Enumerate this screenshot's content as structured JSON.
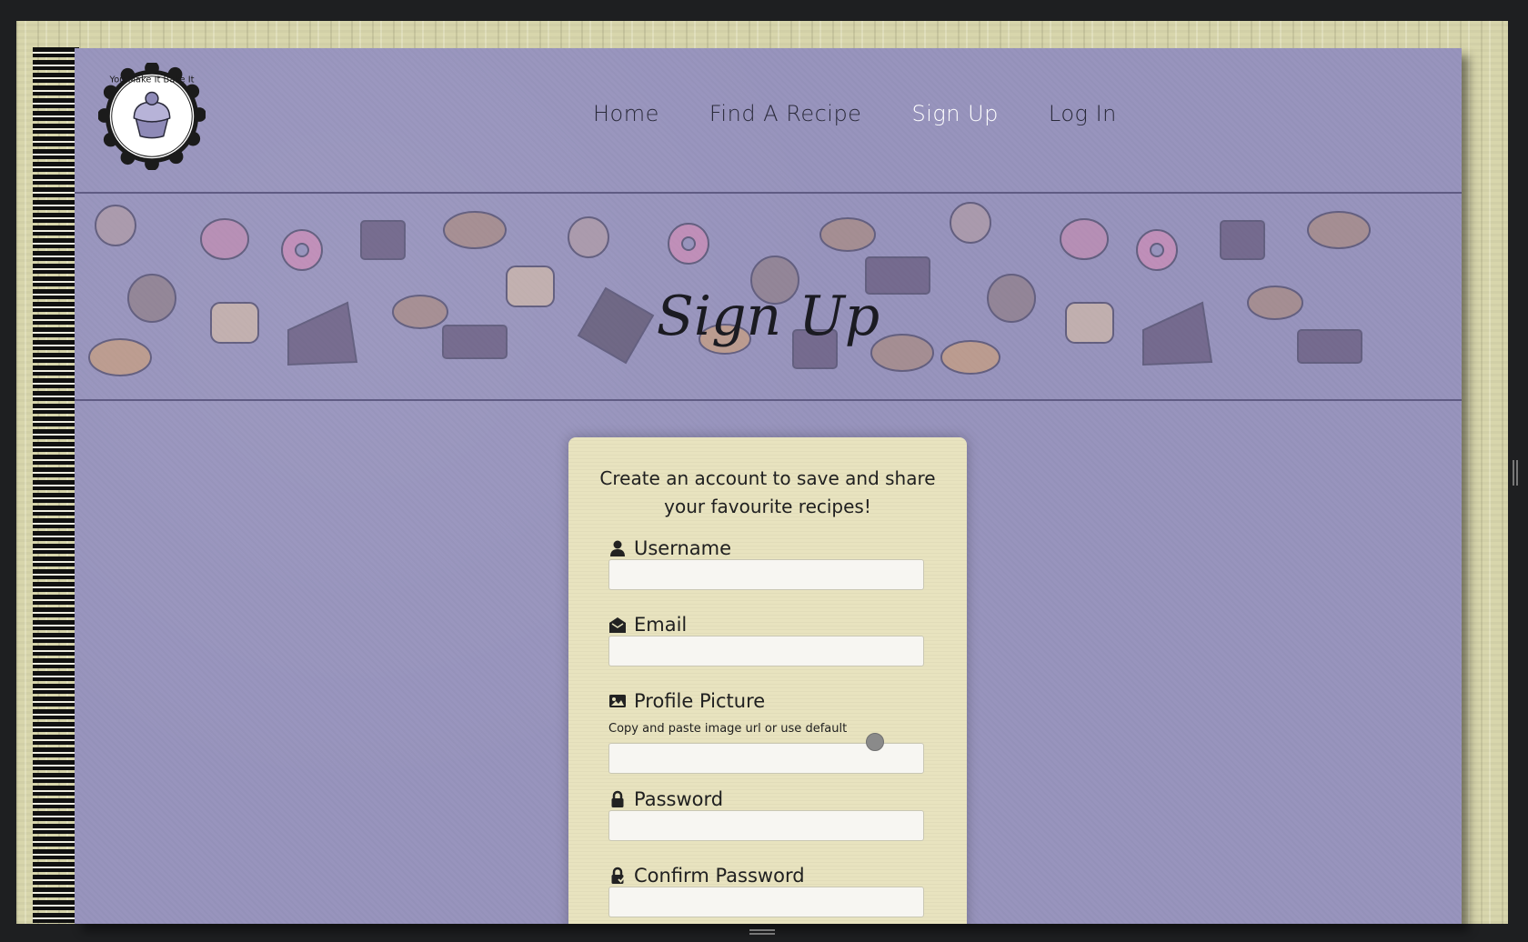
{
  "logo": {
    "text": "You Make It Bake It"
  },
  "nav": {
    "items": [
      {
        "label": "Home",
        "active": false
      },
      {
        "label": "Find A Recipe",
        "active": false
      },
      {
        "label": "Sign Up",
        "active": true
      },
      {
        "label": "Log In",
        "active": false
      }
    ]
  },
  "banner": {
    "title": "Sign Up"
  },
  "form": {
    "intro": "Create an account to save and share your favourite recipes!",
    "fields": {
      "username": {
        "label": "Username",
        "value": ""
      },
      "email": {
        "label": "Email",
        "value": ""
      },
      "profile_picture": {
        "label": "Profile Picture",
        "hint": "Copy and paste image url or use default",
        "value": ""
      },
      "password": {
        "label": "Password",
        "value": ""
      },
      "confirm_password": {
        "label": "Confirm Password",
        "value": ""
      }
    }
  },
  "colors": {
    "page_bg": "#9894bd",
    "card_bg": "#e8e3bf",
    "nav_active": "#ffffff",
    "nav_text": "#2a2a3a"
  }
}
